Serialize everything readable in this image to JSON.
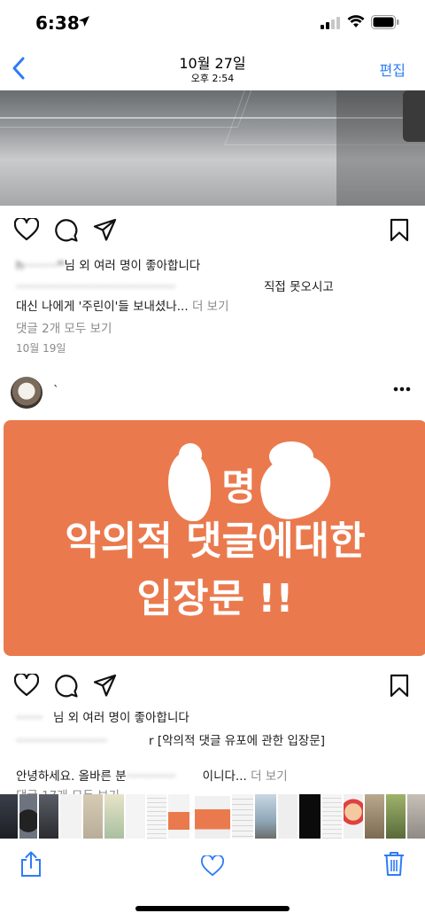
{
  "status_bar": {
    "time": "6:38"
  },
  "header": {
    "title": "10월 27일",
    "subtitle": "오후 2:54",
    "edit_label": "편집"
  },
  "post1": {
    "likes_text": "님 외 여러 명이 좋아합니다",
    "likes_blurred_user": "h·········ᴹ",
    "caption_line1_partial": "직접 못오시고",
    "caption_line2": "대신 나에게 '주린이'들 보내셨나...",
    "more_label": "더 보기",
    "view_comments": "댓글 2개 모두 보기",
    "date": "10월 19일"
  },
  "post2": {
    "card_lines": [
      "애 명",
      "악의적 댓글에대한",
      "입장문 !!"
    ],
    "likes_text": "님 외 여러 명이 좋아합니다",
    "caption_title": "r [악의적 댓글 유포에 관한 입장문]",
    "caption_line": "안녕하세요. 올바른 분",
    "caption_tail": "이니다...",
    "more_label": "더 보기",
    "view_comments_partial": "댓글 17개 모두 보기"
  },
  "colors": {
    "accent": "#2e7cf6",
    "card": "#ea7a4e"
  },
  "icons": [
    "location-arrow-icon",
    "signal-icon",
    "wifi-icon",
    "battery-icon",
    "back-chevron-icon",
    "heart-icon",
    "comment-icon",
    "send-icon",
    "bookmark-icon",
    "more-icon",
    "share-icon",
    "favorite-heart-icon",
    "trash-icon"
  ]
}
